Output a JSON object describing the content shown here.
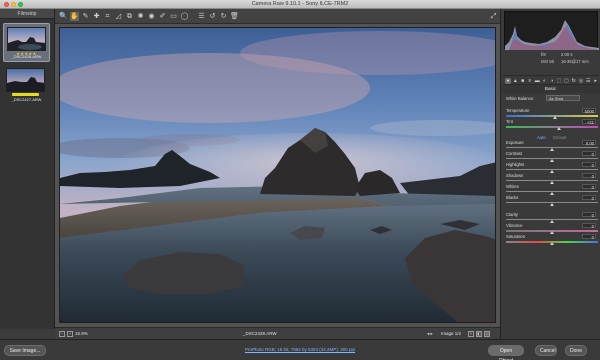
{
  "window": {
    "title": "Camera Raw 9.10.1  -  Sony ILCE-7RM2"
  },
  "filmstrip": {
    "title": "Filmstrip",
    "items": [
      {
        "caption": "_DSC2428.ARW",
        "stars": "★★★★★",
        "selected": true
      },
      {
        "caption": "_DSC2427.ARW",
        "stars": "",
        "selected": false
      }
    ]
  },
  "toolbar": {
    "tools": [
      "zoom-icon",
      "hand-icon",
      "white-balance-icon",
      "color-sampler-icon",
      "crop-icon",
      "straighten-icon",
      "transform-icon",
      "spot-removal-icon",
      "red-eye-icon",
      "adjustment-brush-icon",
      "graduated-filter-icon",
      "radial-filter-icon",
      "preferences-icon",
      "rotate-left-icon",
      "rotate-right-icon",
      "trash-icon"
    ],
    "glyphs": [
      "🔍",
      "✋",
      "✎",
      "✚",
      "⌗",
      "◿",
      "⧉",
      "✺",
      "◉",
      "✐",
      "▭",
      "◯",
      "☰",
      "↺",
      "↻",
      "🗑"
    ],
    "fullscreen_glyph": "⤢"
  },
  "status": {
    "zoom": "15.9%",
    "filename": "_DSC2428.ARW",
    "image_count": "Image 1/2",
    "view_y": "Y",
    "view_compare": "◧",
    "view_settings": "▤"
  },
  "camera_info": {
    "aperture": "f/8",
    "shutter": "2.00 s",
    "iso": "ISO 50",
    "lens": "16-35@17 mm"
  },
  "panel": {
    "section": "Basic",
    "tabs": [
      "●",
      "▲",
      "■",
      "≡",
      "▬",
      "◐",
      "◑",
      "⬚",
      "▢",
      "fx",
      "◎",
      "☰",
      "▸"
    ],
    "white_balance_label": "White Balance:",
    "white_balance_value": "As Shot",
    "rows": [
      {
        "label": "Temperature",
        "value": "5000",
        "slider": "temp",
        "pos": 0.53
      },
      {
        "label": "Tint",
        "value": "+21",
        "slider": "tint",
        "pos": 0.58
      },
      {
        "label": "Exposure",
        "value": "0.00",
        "slider": "plain",
        "pos": 0.5
      },
      {
        "label": "Contrast",
        "value": "0",
        "slider": "plain",
        "pos": 0.5
      },
      {
        "label": "Highlights",
        "value": "0",
        "slider": "plain",
        "pos": 0.5
      },
      {
        "label": "Shadows",
        "value": "0",
        "slider": "plain",
        "pos": 0.5
      },
      {
        "label": "Whites",
        "value": "0",
        "slider": "plain",
        "pos": 0.5
      },
      {
        "label": "Blacks",
        "value": "0",
        "slider": "plain",
        "pos": 0.5
      },
      {
        "label": "Clarity",
        "value": "0",
        "slider": "plain",
        "pos": 0.5
      },
      {
        "label": "Vibrance",
        "value": "0",
        "slider": "vib",
        "pos": 0.5
      },
      {
        "label": "Saturation",
        "value": "0",
        "slider": "sat",
        "pos": 0.5
      }
    ],
    "auto_label": "Auto",
    "default_label": "Default"
  },
  "bottom": {
    "save_label": "Save Image...",
    "workflow_label": "ProPhoto RGB; 16 bit; 7952 by 5304 (42.2MP); 300 ppi",
    "open_label": "Open Object",
    "cancel_label": "Cancel",
    "done_label": "Done"
  }
}
